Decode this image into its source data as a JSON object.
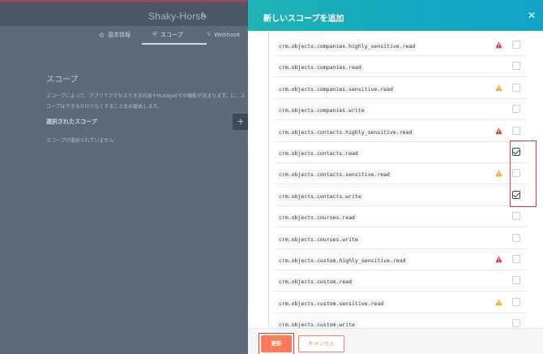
{
  "app": {
    "title": "Shaky-Horse",
    "tabs": [
      {
        "label": "基本情報",
        "icon": "gear-icon"
      },
      {
        "label": "スコープ",
        "icon": "shield-icon"
      },
      {
        "label": "Webhook",
        "icon": "lightning-icon"
      }
    ],
    "section_title": "スコープ",
    "description": "スコープによって、アプリでアクセスできる内容やHubSpotでの機能が決まります。に、スコープはできるだけ少なくすることをお勧めします。",
    "selected_title": "選択されたスコープ",
    "empty_text": "スコープが選択されていません",
    "add_label": "+"
  },
  "panel": {
    "title": "新しいスコープを追加",
    "close_icon": "close-icon",
    "scopes": [
      {
        "name": "crm.objects.companies.highly_sensitive.read",
        "warning": "red",
        "checked": false
      },
      {
        "name": "crm.objects.companies.read",
        "warning": "",
        "checked": false
      },
      {
        "name": "crm.objects.companies.sensitive.read",
        "warning": "orange",
        "checked": false
      },
      {
        "name": "crm.objects.companies.write",
        "warning": "",
        "checked": false
      },
      {
        "name": "crm.objects.contacts.highly_sensitive.read",
        "warning": "red",
        "checked": false
      },
      {
        "name": "crm.objects.contacts.read",
        "warning": "",
        "checked": true
      },
      {
        "name": "crm.objects.contacts.sensitive.read",
        "warning": "orange",
        "checked": false
      },
      {
        "name": "crm.objects.contacts.write",
        "warning": "",
        "checked": true
      },
      {
        "name": "crm.objects.courses.read",
        "warning": "",
        "checked": false
      },
      {
        "name": "crm.objects.courses.write",
        "warning": "",
        "checked": false
      },
      {
        "name": "crm.objects.custom.highly_sensitive.read",
        "warning": "red",
        "checked": false
      },
      {
        "name": "crm.objects.custom.read",
        "warning": "",
        "checked": false
      },
      {
        "name": "crm.objects.custom.sensitive.read",
        "warning": "orange",
        "checked": false
      },
      {
        "name": "crm.objects.custom.write",
        "warning": "",
        "checked": false
      }
    ],
    "update_label": "更新",
    "cancel_label": "キャンセル"
  },
  "colors": {
    "header_gradient_start": "#1fb3b5",
    "header_gradient_end": "#11a4c7",
    "primary_button": "#ff7a59",
    "warning_red": "#d8373f",
    "warning_orange": "#f5a623",
    "highlight": "#d63d3d"
  }
}
